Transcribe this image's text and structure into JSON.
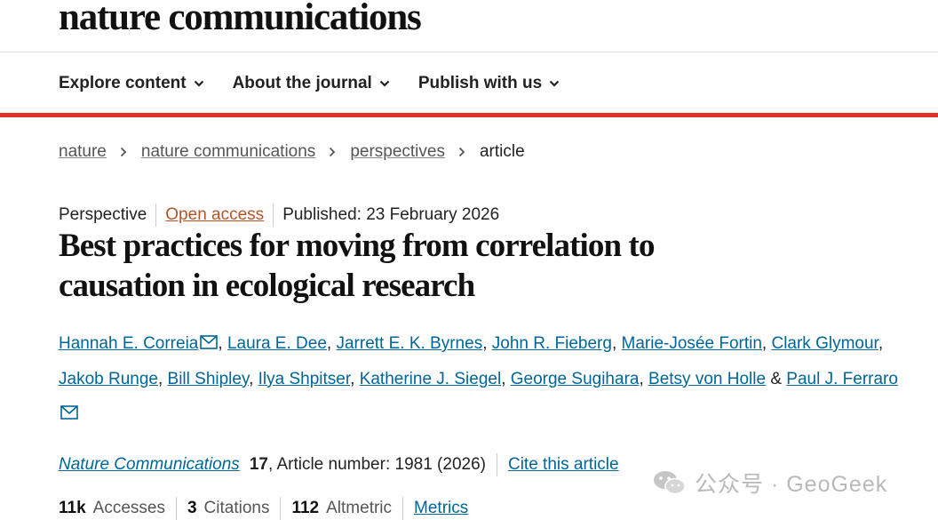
{
  "header": {
    "logo": "nature communications"
  },
  "nav": {
    "items": [
      {
        "label": "Explore content"
      },
      {
        "label": "About the journal"
      },
      {
        "label": "Publish with us"
      }
    ]
  },
  "breadcrumb": {
    "items": [
      "nature",
      "nature communications",
      "perspectives"
    ],
    "current": "article"
  },
  "article": {
    "type": "Perspective",
    "access": "Open access",
    "published": "Published: 23 February 2026",
    "title": "Best practices for moving from correlation to causation in ecological research",
    "authors": [
      "Hannah E. Correia",
      "Laura E. Dee",
      "Jarrett E. K. Byrnes",
      "John R. Fieberg",
      "Marie-Josée Fortin",
      "Clark Glymour",
      "Jakob Runge",
      "Bill Shipley",
      "Ilya Shpitser",
      "Katherine J. Siegel",
      "George Sugihara",
      "Betsy von Holle",
      "Paul J. Ferraro"
    ],
    "journal": "Nature Communications",
    "volume": "17",
    "article_number": ", Article number: 1981 (2026)",
    "cite_label": "Cite this article",
    "metrics": {
      "accesses_value": "11k",
      "accesses_label": "Accesses",
      "citations_value": "3",
      "citations_label": "Citations",
      "altmetric_value": "112",
      "altmetric_label": "Altmetric",
      "metrics_link": "Metrics"
    }
  },
  "watermark": {
    "text": "公众号 · GeoGeek"
  },
  "colors": {
    "accent_red": "#e0312b",
    "link_blue": "#006699",
    "open_access": "#b5542a"
  }
}
